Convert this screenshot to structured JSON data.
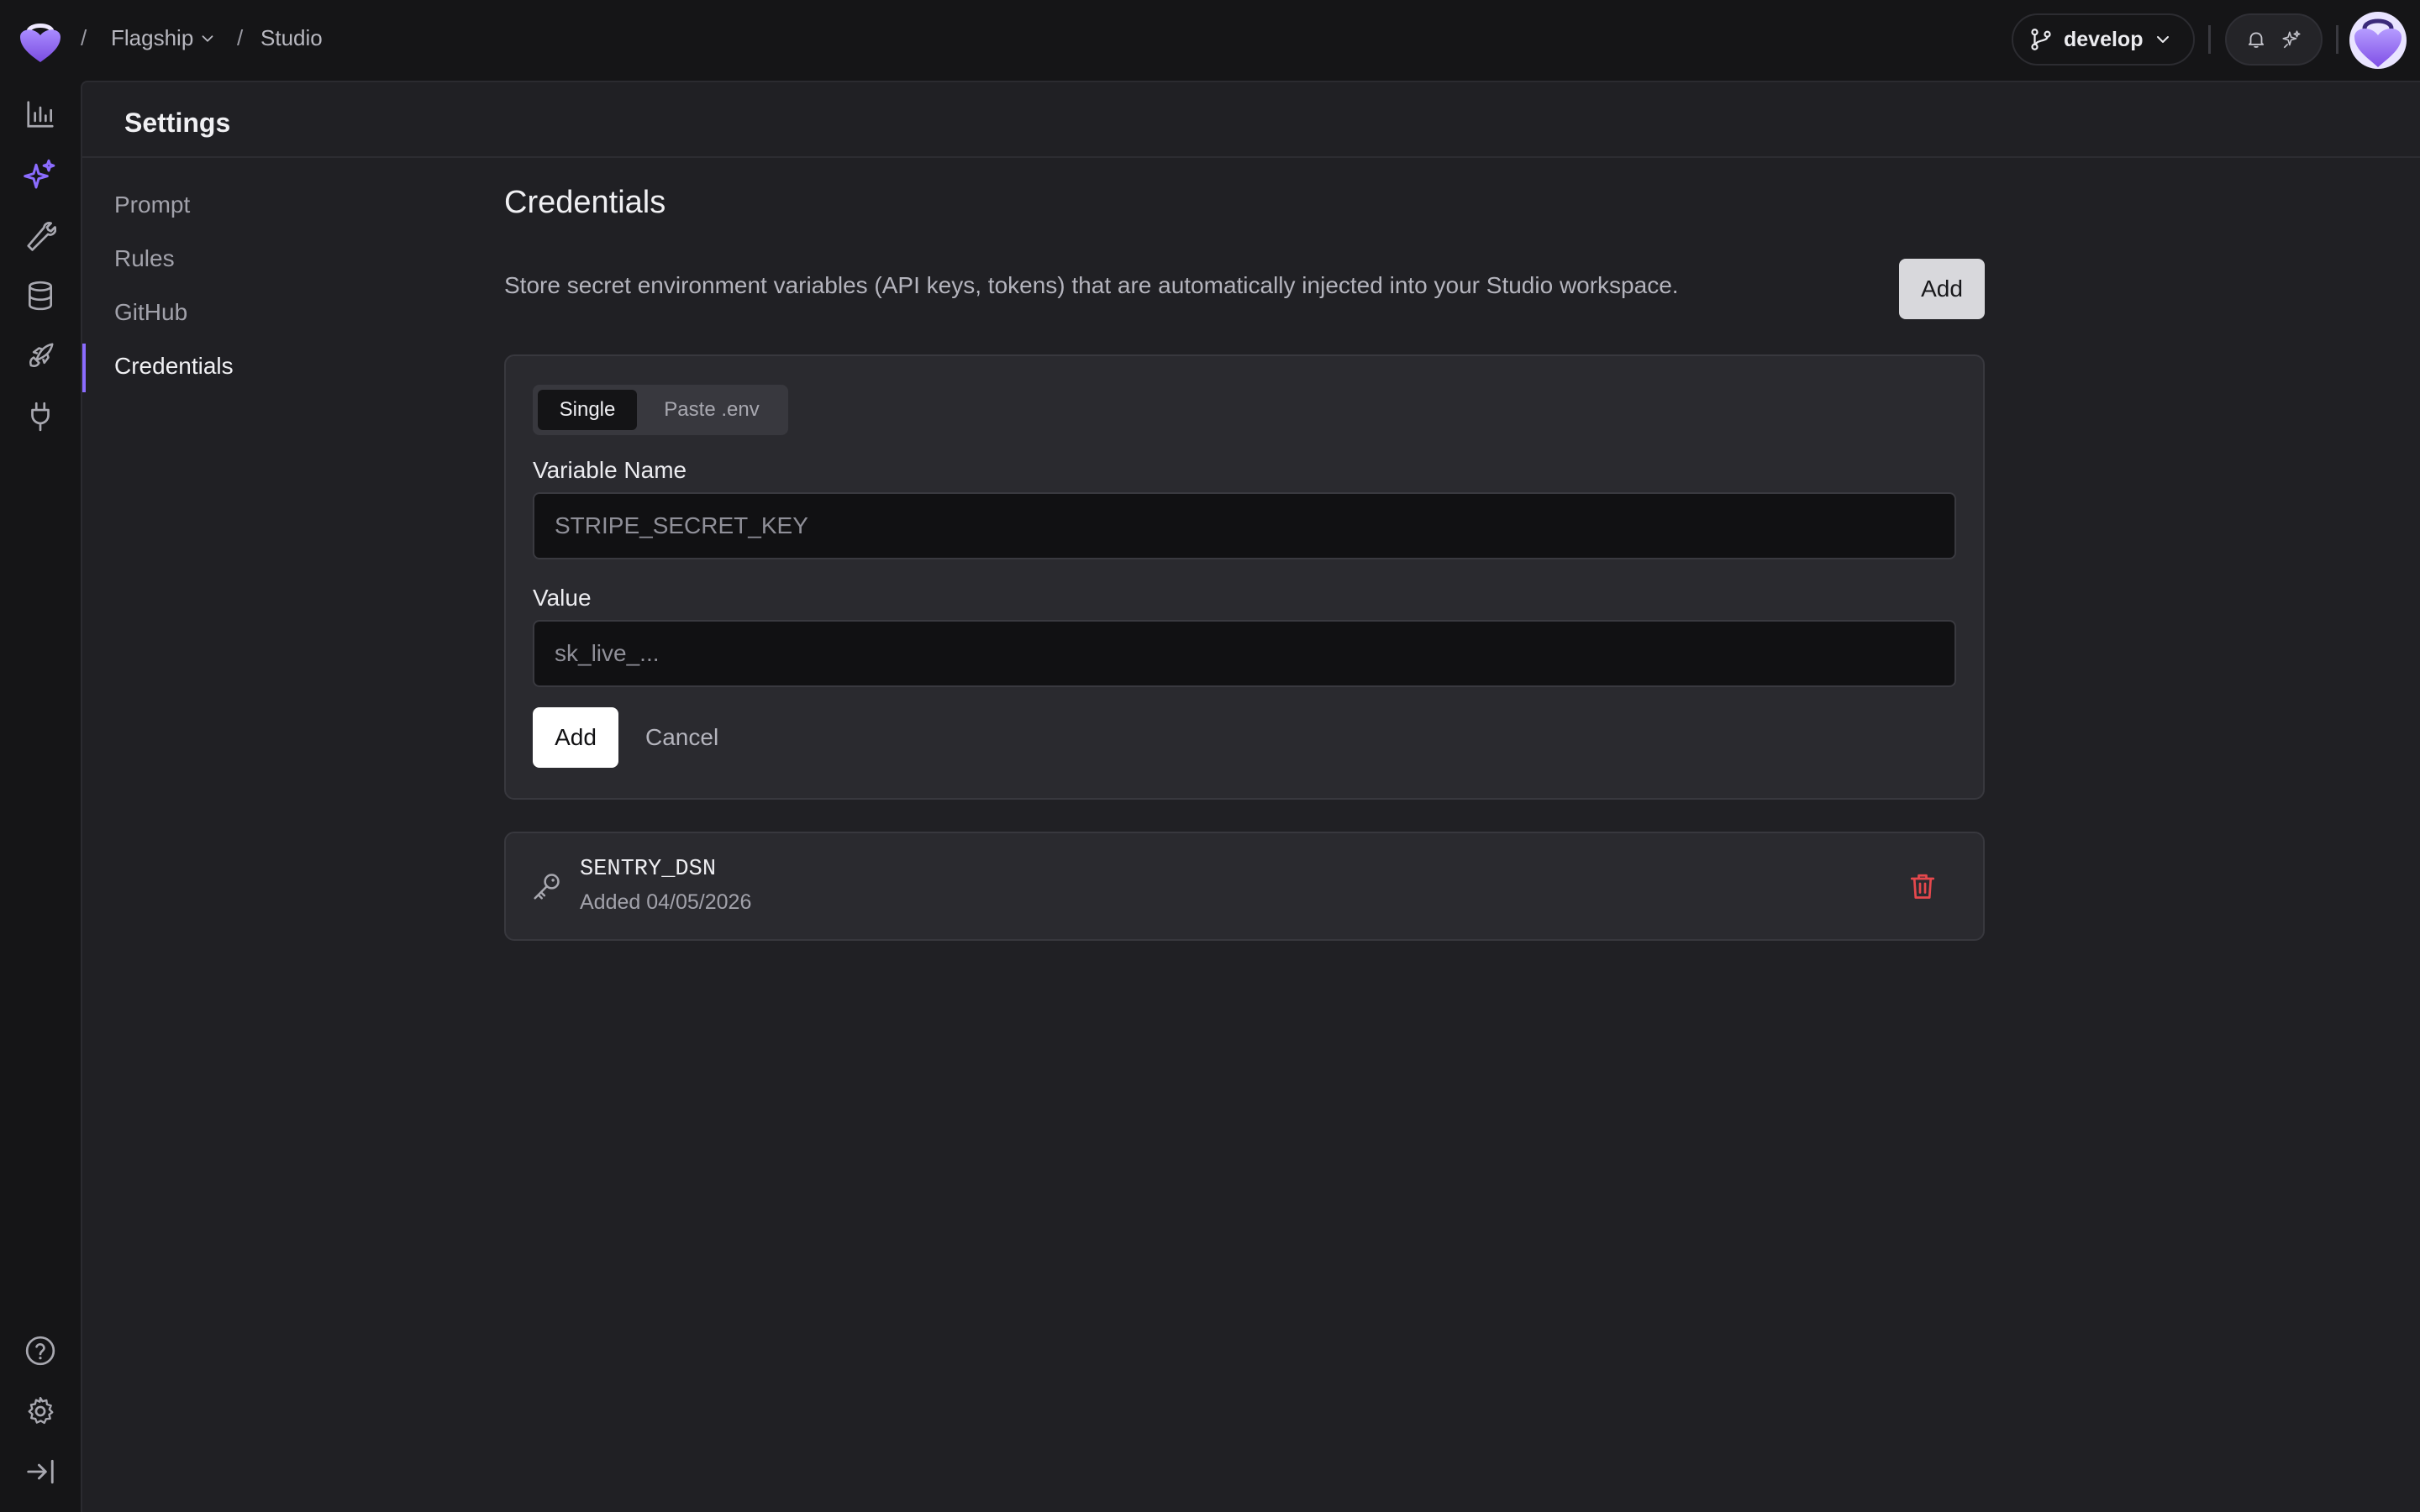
{
  "colors": {
    "accent": "#8b6cff",
    "danger": "#e5484d",
    "background": "#151517",
    "panel": "#202024"
  },
  "breadcrumb": {
    "project": "Flagship",
    "page": "Studio",
    "separator": "/"
  },
  "topbar": {
    "branch_label": "develop",
    "icons": [
      "branch-icon",
      "chevron-down-icon",
      "bell-icon",
      "sparkle-icon",
      "avatar"
    ]
  },
  "rail": {
    "icons": [
      "analytics-icon",
      "sparkles-icon",
      "wrench-icon",
      "database-icon",
      "rocket-icon",
      "plug-icon",
      "help-icon",
      "gear-icon",
      "collapse-sidebar-icon"
    ]
  },
  "settings": {
    "title": "Settings",
    "nav": [
      "Prompt",
      "Rules",
      "GitHub",
      "Credentials"
    ],
    "active_nav": "Credentials"
  },
  "credentials": {
    "title": "Credentials",
    "description": "Store secret environment variables (API keys, tokens) that are automatically injected into your Studio workspace.",
    "add_label": "Add",
    "form": {
      "mode_single": "Single",
      "mode_paste": "Paste .env",
      "selected_mode": "Single",
      "name_label": "Variable Name",
      "name_placeholder": "STRIPE_SECRET_KEY",
      "value_label": "Value",
      "value_placeholder": "sk_live_...",
      "submit_label": "Add",
      "cancel_label": "Cancel"
    },
    "items": [
      {
        "name": "SENTRY_DSN",
        "added": "Added 04/05/2026"
      }
    ]
  }
}
